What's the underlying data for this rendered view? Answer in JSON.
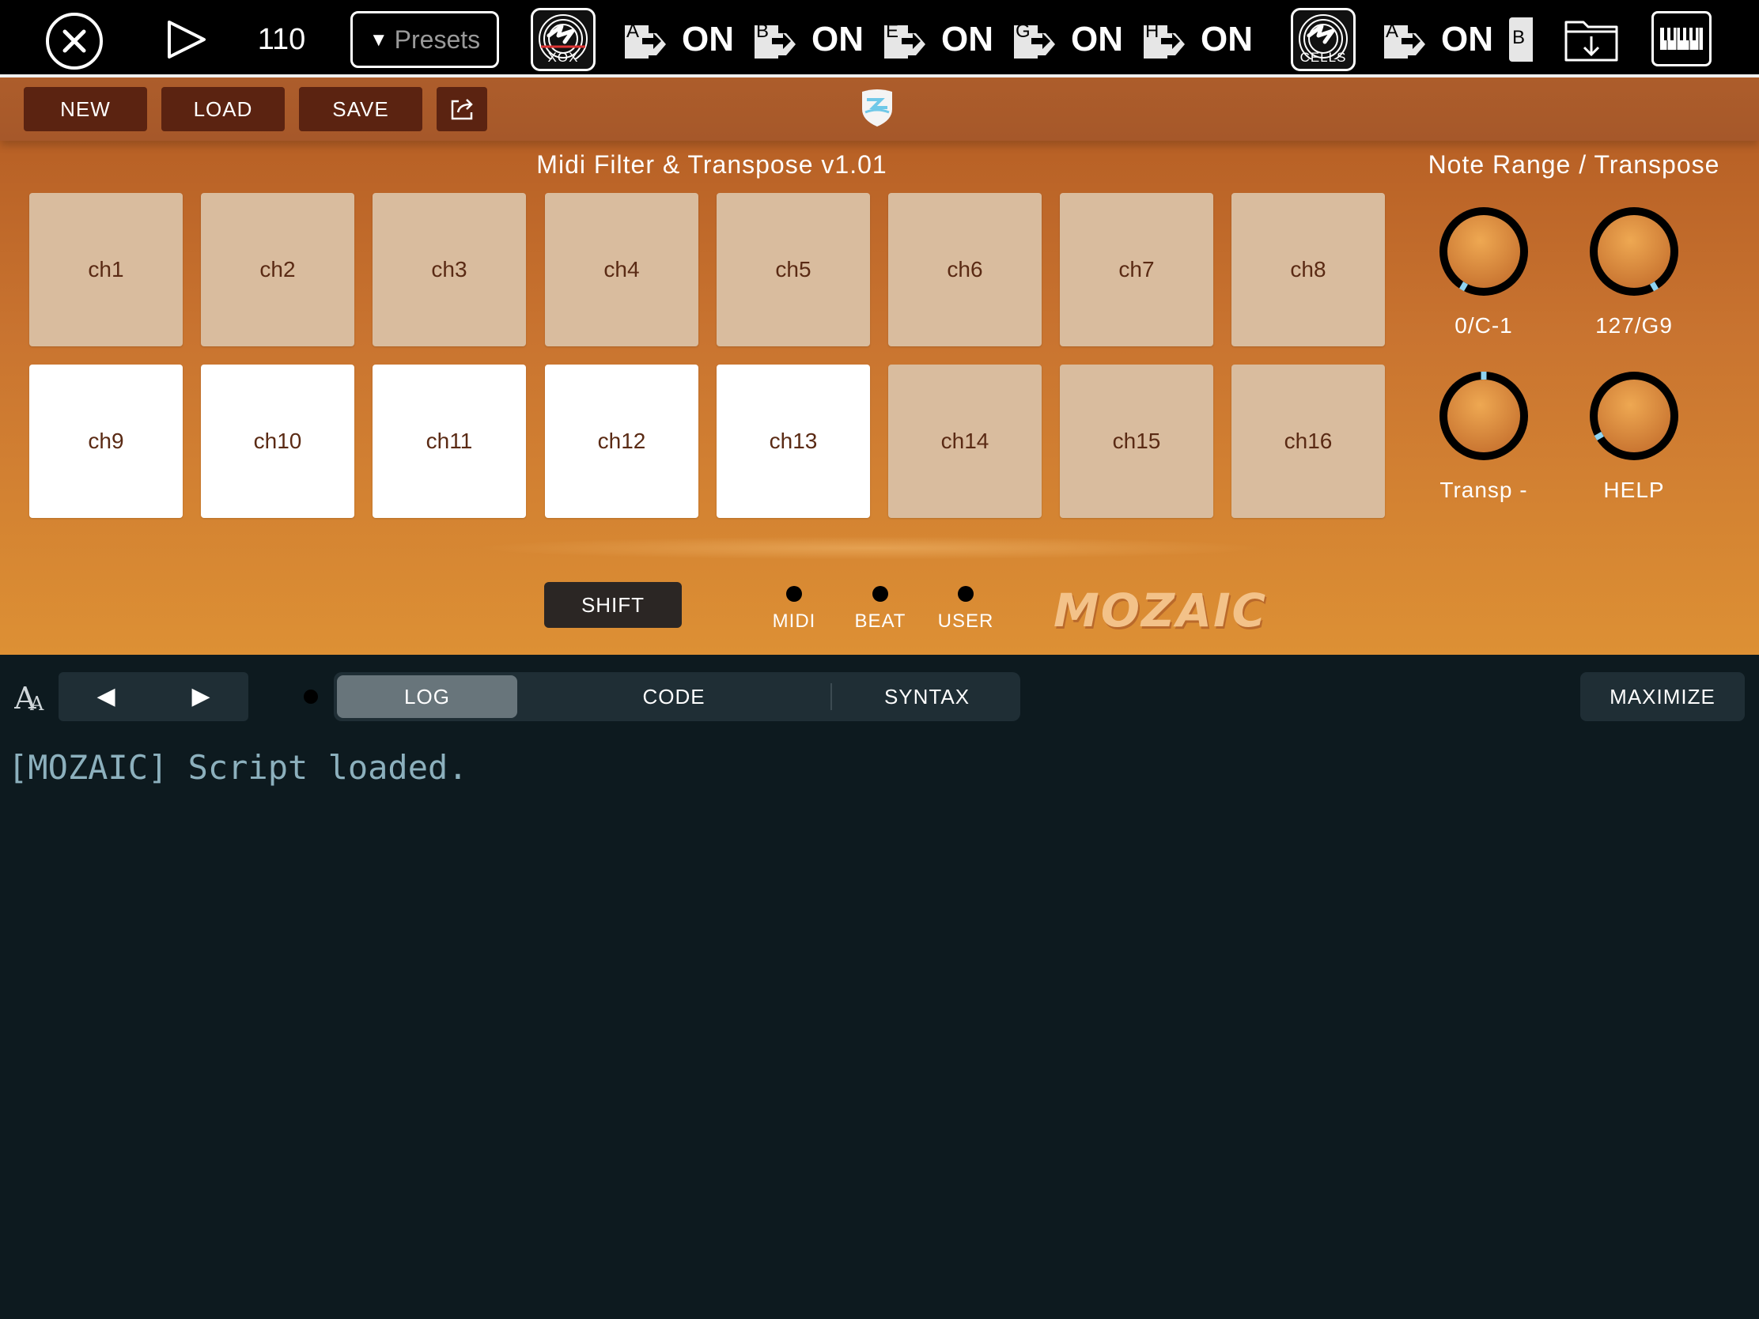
{
  "host": {
    "tempo": "110",
    "presets_label": "Presets",
    "apps": [
      {
        "label": "XOX"
      },
      {
        "label": "CELLS"
      }
    ],
    "ports": [
      {
        "letter": "A",
        "state": "ON"
      },
      {
        "letter": "B",
        "state": "ON"
      },
      {
        "letter": "E",
        "state": "ON"
      },
      {
        "letter": "G",
        "state": "ON"
      },
      {
        "letter": "H",
        "state": "ON"
      },
      {
        "letter": "A",
        "state": "ON"
      }
    ],
    "partial_port_letter": "B"
  },
  "toolbar": {
    "new_label": "NEW",
    "load_label": "LOAD",
    "save_label": "SAVE"
  },
  "panel": {
    "title": "Midi Filter & Transpose v1.01",
    "side_title": "Note Range / Transpose",
    "pads": [
      {
        "label": "ch1",
        "active": false
      },
      {
        "label": "ch2",
        "active": false
      },
      {
        "label": "ch3",
        "active": false
      },
      {
        "label": "ch4",
        "active": false
      },
      {
        "label": "ch5",
        "active": false
      },
      {
        "label": "ch6",
        "active": false
      },
      {
        "label": "ch7",
        "active": false
      },
      {
        "label": "ch8",
        "active": false
      },
      {
        "label": "ch9",
        "active": true
      },
      {
        "label": "ch10",
        "active": true
      },
      {
        "label": "ch11",
        "active": true
      },
      {
        "label": "ch12",
        "active": true
      },
      {
        "label": "ch13",
        "active": true
      },
      {
        "label": "ch14",
        "active": false
      },
      {
        "label": "ch15",
        "active": false
      },
      {
        "label": "ch16",
        "active": false
      }
    ],
    "knobs": [
      {
        "label": "0/C-1",
        "value": 0.0
      },
      {
        "label": "127/G9",
        "value": 1.0
      },
      {
        "label": "Transp -",
        "value": 0.5
      },
      {
        "label": "HELP",
        "value": 0.1
      }
    ],
    "shift_label": "SHIFT",
    "leds": [
      {
        "label": "MIDI"
      },
      {
        "label": "BEAT"
      },
      {
        "label": "USER"
      }
    ],
    "logo": "MOZAIC"
  },
  "editor": {
    "tabs": [
      {
        "label": "LOG",
        "active": true
      },
      {
        "label": "CODE",
        "active": false
      },
      {
        "label": "SYNTAX",
        "active": false
      }
    ],
    "maximize_label": "MAXIMIZE",
    "log_lines": [
      "[MOZAIC] Script loaded."
    ]
  },
  "colors": {
    "pad_off": "#d9bc9e",
    "pad_on": "#ffffff",
    "knob_indicator": "#8fd3f0",
    "editor_bg": "#0d1a1f",
    "log_text": "#8cb0bd"
  }
}
